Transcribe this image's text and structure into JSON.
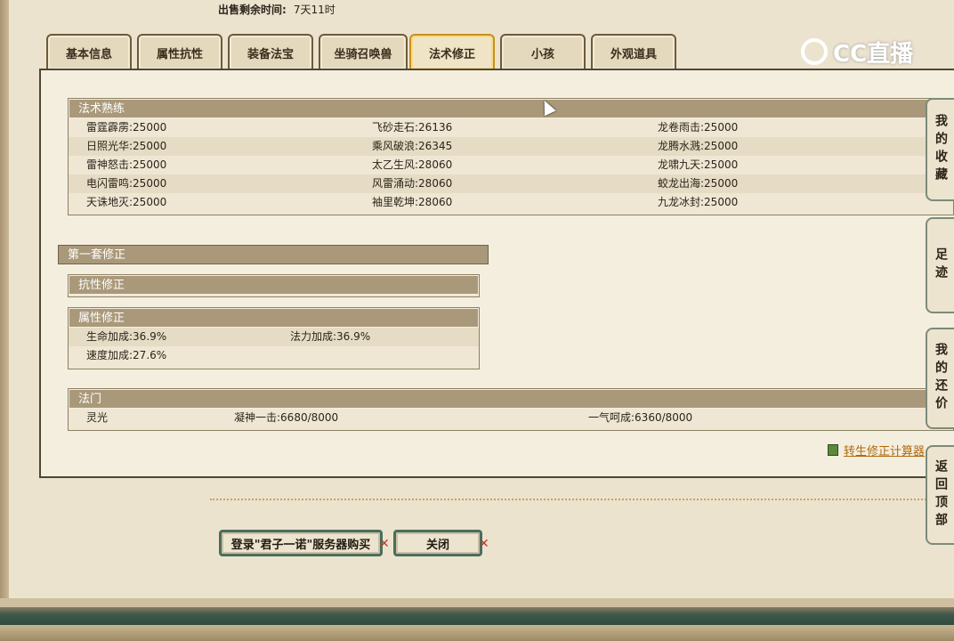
{
  "sale": {
    "label": "出售剩余时间:",
    "value": "7天11时"
  },
  "tabs": [
    "基本信息",
    "属性抗性",
    "装备法宝",
    "坐骑召唤兽",
    "法术修正",
    "小孩",
    "外观道具"
  ],
  "active_tab": "法术修正",
  "logo": {
    "text": "CC直播"
  },
  "spell": {
    "title": "法术熟练",
    "rows": [
      [
        "雷霆霹雳:25000",
        "飞砂走石:26136",
        "龙卷雨击:25000"
      ],
      [
        "日照光华:25000",
        "乘风破浪:26345",
        "龙腾水溅:25000"
      ],
      [
        "雷神怒击:25000",
        "太乙生风:28060",
        "龙啸九天:25000"
      ],
      [
        "电闪雷鸣:25000",
        "风雷涌动:28060",
        "蛟龙出海:25000"
      ],
      [
        "天诛地灭:25000",
        "袖里乾坤:28060",
        "九龙冰封:25000"
      ]
    ]
  },
  "first_set": {
    "title": "第一套修正"
  },
  "resist": {
    "title": "抗性修正"
  },
  "attr": {
    "title": "属性修正",
    "rows": [
      [
        "生命加成:36.9%",
        "法力加成:36.9%"
      ],
      [
        "速度加成:27.6%",
        ""
      ]
    ]
  },
  "fa": {
    "title": "法门",
    "row": [
      "灵光",
      "凝神一击:6680/8000",
      "一气呵成:6360/8000"
    ]
  },
  "calc_link": "转生修正计算器",
  "buttons": {
    "buy": "登录\"君子一诺\"服务器购买",
    "close": "关闭"
  },
  "side": {
    "fav": "我的收藏",
    "foot": "足迹",
    "bargain": "我的还价",
    "top": "返回顶部"
  }
}
